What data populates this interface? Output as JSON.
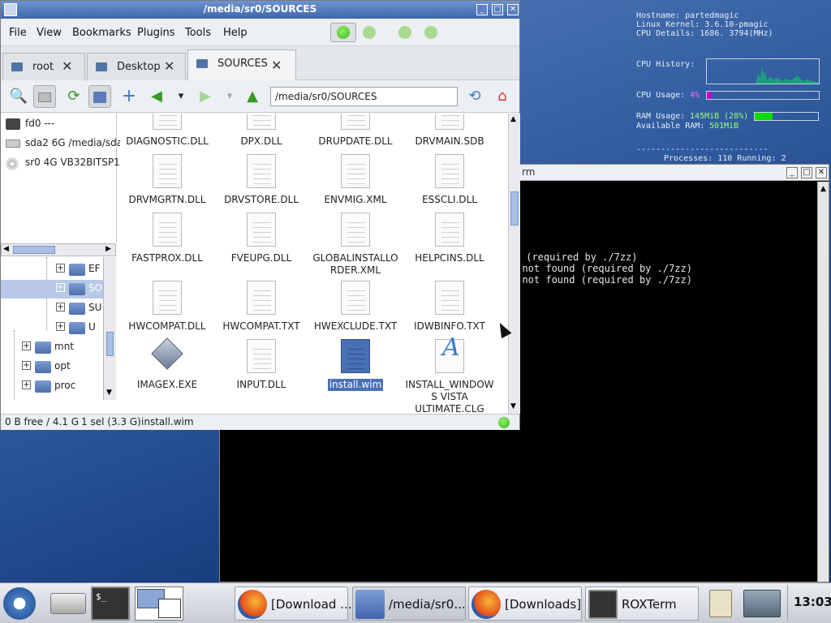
{
  "conky": {
    "hostname": "Hostname: partedmagic",
    "kernel": "Linux Kernel: 3.6.10-pmagic",
    "cpu_details": "CPU Details: 1686. 3794(MHz)",
    "cpu_history_label": "CPU History:",
    "cpu_usage_label": "CPU Usage:",
    "cpu_usage_value": "4%",
    "cpu_usage_fraction": 0.04,
    "ram_usage_label": "RAM Usage:",
    "ram_usage_value": "145MiB (28%)",
    "ram_usage_fraction": 0.28,
    "available_ram_label": "Available RAM:",
    "available_ram_value": "501MiB",
    "dashes": "---------------------------",
    "processes": "Processes: 110  Running: 2"
  },
  "terminal": {
    "title": "rm",
    "lines": [
      " (required by ./7zz)",
      "' not found (required by ./7zz)",
      "' not found (required by ./7zz)"
    ]
  },
  "fm": {
    "title": "/media/sr0/SOURCES",
    "menu": [
      "File",
      "View",
      "Bookmarks",
      "Plugins",
      "Tools",
      "Help"
    ],
    "tabs": [
      {
        "label": "root"
      },
      {
        "label": "Desktop"
      },
      {
        "label": "SOURCES"
      }
    ],
    "path": "/media/sr0/SOURCES",
    "devices": [
      "fd0 ---",
      "sda2 6G /media/sda",
      "sr0 4G VB32BITSP1"
    ],
    "tree": [
      {
        "label": "EF",
        "sign": "+"
      },
      {
        "label": "SO",
        "sign": "+"
      },
      {
        "label": "SU",
        "sign": "+"
      },
      {
        "label": "U",
        "sign": "+"
      },
      {
        "label": "mnt",
        "sign": "+"
      },
      {
        "label": "opt",
        "sign": "+"
      },
      {
        "label": "proc",
        "sign": "+"
      }
    ],
    "files": [
      "DIAGNOSTIC.DLL",
      "DPX.DLL",
      "DRUPDATE.DLL",
      "DRVMAIN.SDB",
      "DRVMGRTN.DLL",
      "DRVSTORE.DLL",
      "ENVMIG.XML",
      "ESSCLI.DLL",
      "FASTPROX.DLL",
      "FVEUPG.DLL",
      "GLOBALINSTALLO RDER.XML",
      "HELPCINS.DLL",
      "HWCOMPAT.DLL",
      "HWCOMPAT.TXT",
      "HWEXCLUDE.TXT",
      "IDWBINFO.TXT",
      "IMAGEX.EXE",
      "INPUT.DLL",
      "install.wim",
      "INSTALL_WINDOW S VISTA ULTIMATE.CLG"
    ],
    "selected_file": "install.wim",
    "status": {
      "free": "0 B free / 4.1 G",
      "sel": "1 sel (3.3 G)",
      "name": "install.wim"
    }
  },
  "panel": {
    "tasks": [
      {
        "label": "[Download ..."
      },
      {
        "label": "/media/sr0..."
      },
      {
        "label": "[Downloads]"
      },
      {
        "label": "ROXTerm"
      }
    ],
    "clock": "13:03"
  },
  "colors": {
    "title_blue": "#3e66ad",
    "selection": "#4a6fb5",
    "cpu_bar": "#cc00cc",
    "ram_bar": "#00dd00",
    "led_green": "#3cb81c"
  }
}
